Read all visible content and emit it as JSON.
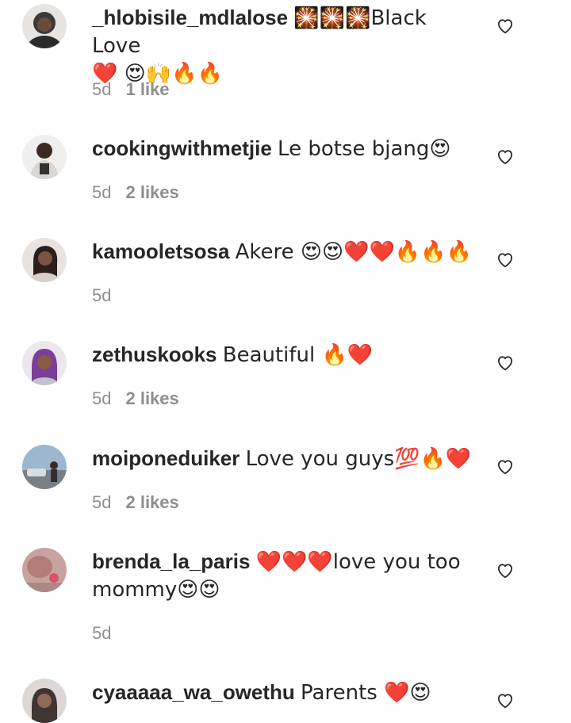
{
  "comments": [
    {
      "username": "_hlobisile_mdlalose",
      "text_line1": "🎇🎇🎇Black Love",
      "text_line2": "❤️ 😍🙌🔥🔥",
      "time": "5d",
      "likes": "1 like",
      "avatar_color": "#3a3a3a"
    },
    {
      "username": "cookingwithmetjie",
      "text": "Le botse bjang😍",
      "time": "5d",
      "likes": "2 likes",
      "avatar_color": "#8a7d77"
    },
    {
      "username": "kamooletsosa",
      "text": "Akere 😍😍❤️❤️🔥🔥🔥",
      "time": "5d",
      "likes": "",
      "avatar_color": "#4a3b36"
    },
    {
      "username": "zethuskooks",
      "text": "Beautiful 🔥❤️",
      "time": "5d",
      "likes": "2 likes",
      "avatar_color": "#8b5fa3"
    },
    {
      "username": "moiponeduiker",
      "text": "Love you guys💯🔥❤️",
      "time": "5d",
      "likes": "2 likes",
      "avatar_color": "#6f8da8"
    },
    {
      "username": "brenda_la_paris",
      "text_line1": "❤️❤️❤️love you too",
      "text_line2": "mommy😍😍",
      "time": "5d",
      "likes": "",
      "avatar_color": "#b98a8a"
    },
    {
      "username": "cyaaaaa_wa_owethu",
      "text": "Parents ❤️😍",
      "time": "",
      "likes": "",
      "avatar_color": "#5a5452"
    }
  ],
  "colors": {
    "text": "#262626",
    "muted": "#8e8e8e",
    "background": "#ffffff"
  },
  "icons": {
    "like": "heart-outline-icon"
  }
}
